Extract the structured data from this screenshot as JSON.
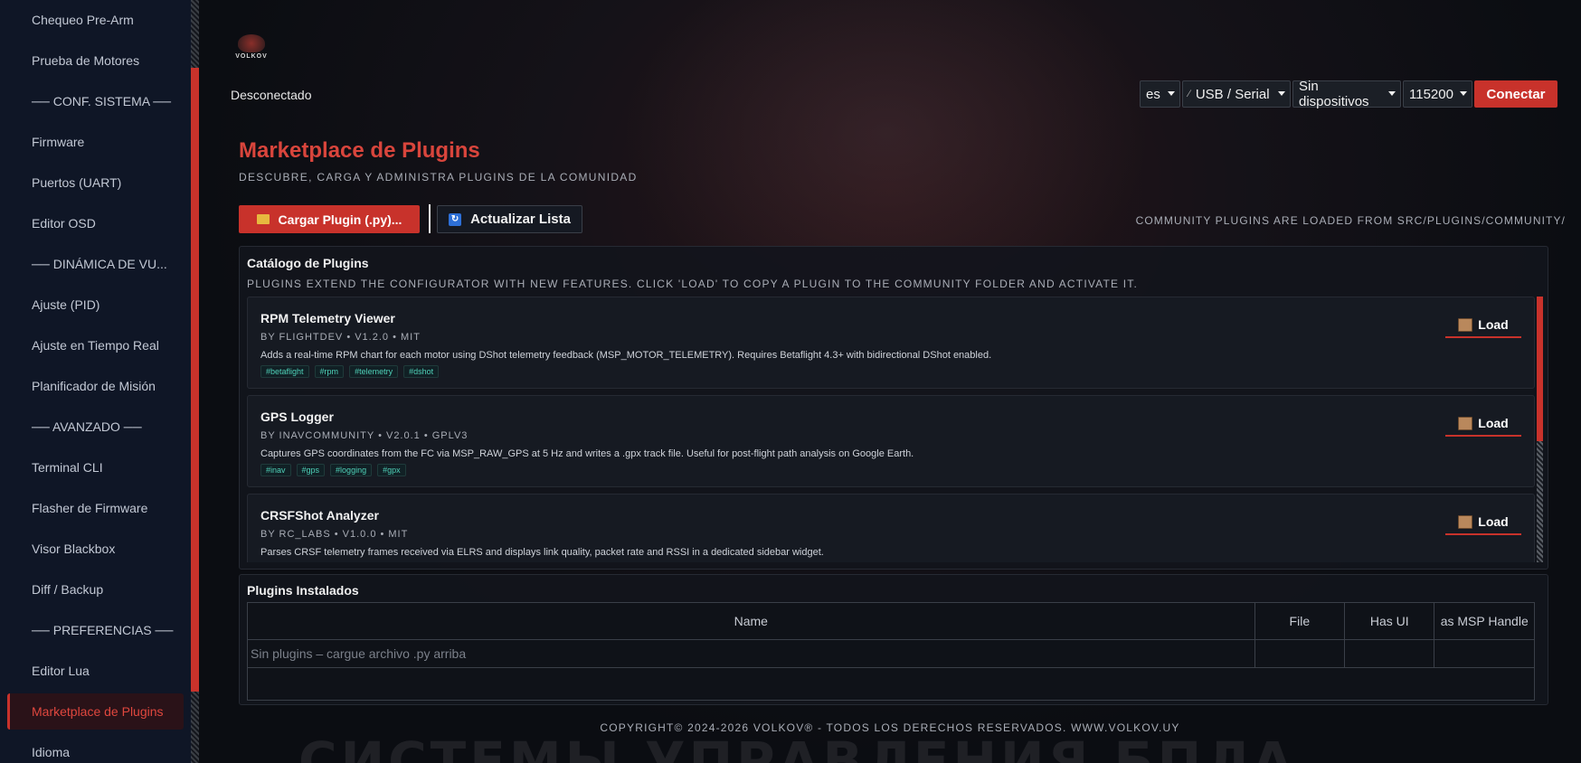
{
  "sidebar": {
    "items": [
      {
        "label": "Chequeo Pre-Arm",
        "type": "item"
      },
      {
        "label": "Prueba de Motores",
        "type": "item"
      },
      {
        "label": "── CONF. SISTEMA ──",
        "type": "section"
      },
      {
        "label": "Firmware",
        "type": "item"
      },
      {
        "label": "Puertos (UART)",
        "type": "item"
      },
      {
        "label": "Editor OSD",
        "type": "item"
      },
      {
        "label": "── DINÁMICA DE VU...",
        "type": "section"
      },
      {
        "label": "Ajuste (PID)",
        "type": "item"
      },
      {
        "label": "Ajuste en Tiempo Real",
        "type": "item"
      },
      {
        "label": "Planificador de Misión",
        "type": "item"
      },
      {
        "label": "── AVANZADO ──",
        "type": "section"
      },
      {
        "label": "Terminal CLI",
        "type": "item"
      },
      {
        "label": "Flasher de Firmware",
        "type": "item"
      },
      {
        "label": "Visor Blackbox",
        "type": "item"
      },
      {
        "label": "Diff / Backup",
        "type": "item"
      },
      {
        "label": "── PREFERENCIAS ──",
        "type": "section"
      },
      {
        "label": "Editor Lua",
        "type": "item"
      },
      {
        "label": "Marketplace de Plugins",
        "type": "item",
        "active": true
      },
      {
        "label": "Idioma",
        "type": "item"
      }
    ]
  },
  "header": {
    "logo_text": "VOLKOV",
    "status": "Desconectado",
    "language": "es",
    "port_type": "USB / Serial",
    "device": "Sin dispositivos",
    "baud": "115200",
    "connect_label": "Conectar",
    "port_icon": "plug-icon"
  },
  "page": {
    "title": "Marketplace de Plugins",
    "subtitle": "DESCUBRE, CARGA Y ADMINISTRA PLUGINS DE LA COMUNIDAD",
    "load_button": "Cargar Plugin (.py)...",
    "refresh_button": "Actualizar Lista",
    "community_note": "COMMUNITY PLUGINS ARE LOADED FROM  SRC/PLUGINS/COMMUNITY/"
  },
  "catalog": {
    "title": "Catálogo de Plugins",
    "subtitle": "PLUGINS EXTEND THE CONFIGURATOR WITH NEW FEATURES. CLICK 'LOAD' TO COPY A PLUGIN TO THE COMMUNITY FOLDER AND ACTIVATE IT.",
    "plugins": [
      {
        "name": "RPM Telemetry Viewer",
        "meta": "BY FLIGHTDEV  •  V1.2.0  •  MIT",
        "description": "Adds a real-time RPM chart for each motor using DShot telemetry feedback (MSP_MOTOR_TELEMETRY). Requires Betaflight 4.3+ with bidirectional DShot enabled.",
        "tags": [
          "#betaflight",
          "#rpm",
          "#telemetry",
          "#dshot"
        ],
        "load_label": "Load"
      },
      {
        "name": "GPS Logger",
        "meta": "BY INAVCOMMUNITY  •  V2.0.1  •  GPLV3",
        "description": "Captures GPS coordinates from the FC via MSP_RAW_GPS at 5 Hz and writes a .gpx track file. Useful for post-flight path analysis on Google Earth.",
        "tags": [
          "#inav",
          "#gps",
          "#logging",
          "#gpx"
        ],
        "load_label": "Load"
      },
      {
        "name": "CRSFShot Analyzer",
        "meta": "BY RC_LABS  •  V1.0.0  •  MIT",
        "description": "Parses CRSF telemetry frames received via ELRS and displays link quality, packet rate and RSSI in a dedicated sidebar widget.",
        "tags": [
          "",
          "",
          ""
        ],
        "load_label": "Load"
      }
    ]
  },
  "installed": {
    "title": "Plugins Instalados",
    "columns": [
      "Name",
      "File",
      "Has UI",
      "as MSP Handle"
    ],
    "empty_text": "Sin plugins – cargue archivo .py arriba"
  },
  "footer": "COPYRIGHT© 2024-2026 VOLKOV® - TODOS LOS DERECHOS RESERVADOS. WWW.VOLKOV.UY",
  "background_text": "СИСТЕМЫ УПРАВЛЕНИЯ БПЛА",
  "colors": {
    "accent": "#c8322b",
    "title": "#d9453c",
    "tag": "#4fd1b8"
  }
}
